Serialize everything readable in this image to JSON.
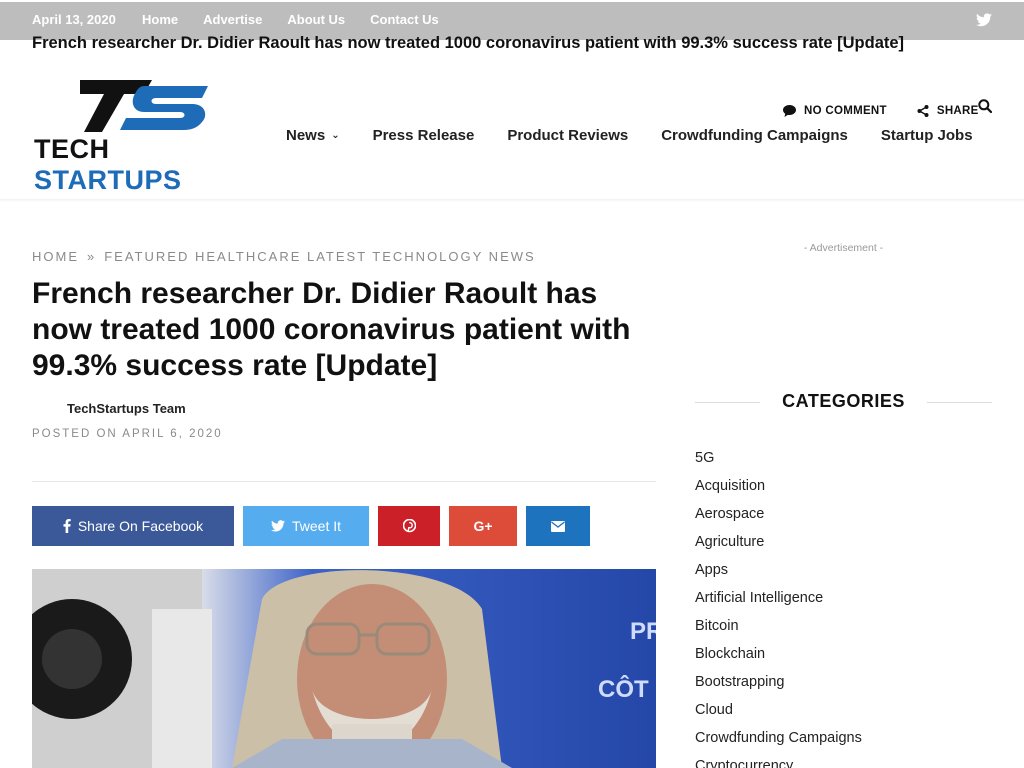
{
  "topbar": {
    "date": "April 13, 2020",
    "links": [
      "Home",
      "Advertise",
      "About Us",
      "Contact Us"
    ],
    "social_icon": "twitter-icon"
  },
  "sticky_title": "French researcher Dr. Didier Raoult has now treated 1000 coronavirus patient with 99.3% success rate [Update]",
  "logo": {
    "monogram": "TS",
    "word1": "TECH",
    "word2": "STARTUPS",
    "colors": {
      "dark": "#111111",
      "blue": "#1e6bb8"
    }
  },
  "nav": {
    "items": [
      "News",
      "Press Release",
      "Product Reviews",
      "Crowdfunding Campaigns",
      "Startup Jobs"
    ],
    "news_dropdown_icon": "chevron-down-icon"
  },
  "meta_actions": {
    "comment_label": "NO COMMENT",
    "share_label": "SHARE"
  },
  "breadcrumb": {
    "home": "HOME",
    "separator": "»",
    "category": "FEATURED HEALTHCARE LATEST TECHNOLOGY NEWS"
  },
  "article": {
    "title": "French researcher Dr. Didier Raoult has now treated 1000 coronavirus patient with 99.3% success rate [Update]",
    "author": "TechStartups Team",
    "posted": "POSTED ON APRIL 6, 2020"
  },
  "share_buttons": {
    "facebook": "Share On Facebook",
    "twitter": "Tweet It",
    "colors": {
      "facebook": "#3b5998",
      "twitter": "#55acee",
      "pinterest": "#cb2027",
      "googleplus": "#dd4b39",
      "email": "#1e73be"
    }
  },
  "sidebar": {
    "ad_label": "- Advertisement -",
    "categories_heading": "CATEGORIES",
    "categories": [
      "5G",
      "Acquisition",
      "Aerospace",
      "Agriculture",
      "Apps",
      "Artificial Intelligence",
      "Bitcoin",
      "Blockchain",
      "Bootstrapping",
      "Cloud",
      "Crowdfunding Campaigns",
      "Cryptocurrency"
    ]
  }
}
